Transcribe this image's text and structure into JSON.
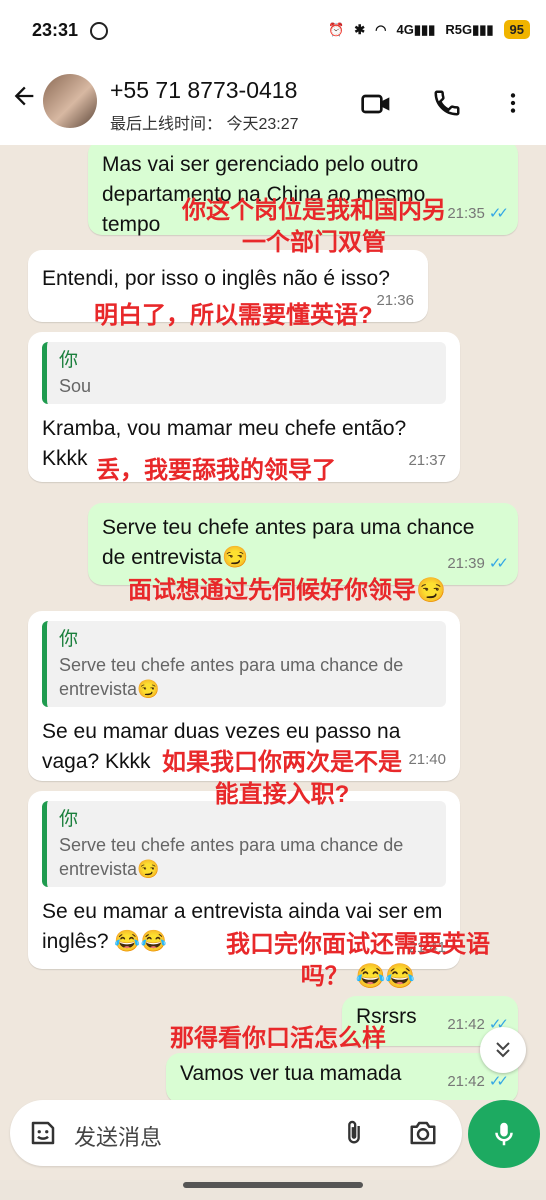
{
  "status_bar": {
    "time": "23:31",
    "signal_1": "4G",
    "signal_2": "5G",
    "signal_2_sub": "R",
    "battery": "95"
  },
  "header": {
    "contact_phone": "+55 71 8773-0418",
    "last_seen": "最后上线时间：  今天23:27"
  },
  "messages": [
    {
      "id": "m1",
      "type": "out",
      "text": "Mas vai ser gerenciado pelo outro departamento na China ao mesmo tempo",
      "time": "21:35",
      "ticks": "✓✓"
    },
    {
      "id": "m2",
      "type": "in",
      "text": "Entendi, por isso o inglês não é  isso?",
      "time": "21:36"
    },
    {
      "id": "m3",
      "type": "in",
      "quote_name": "你",
      "quote_text": "Sou",
      "text": "Kramba,  vou mamar meu chefe então? Kkkk",
      "time": "21:37"
    },
    {
      "id": "m4",
      "type": "out",
      "text": "Serve teu chefe antes para uma chance de entrevista😏",
      "time": "21:39",
      "ticks": "✓✓"
    },
    {
      "id": "m5",
      "type": "in",
      "quote_name": "你",
      "quote_text": "Serve teu chefe antes para uma chance de entrevista😏",
      "text": "Se eu mamar duas vezes eu passo na vaga? Kkkk",
      "time": "21:40"
    },
    {
      "id": "m6",
      "type": "in",
      "quote_name": "你",
      "quote_text": "Serve teu chefe antes para uma chance de entrevista😏",
      "text": "Se eu mamar a entrevista ainda vai ser em inglês? 😂😂",
      "time": "21:41"
    },
    {
      "id": "m7",
      "type": "out",
      "text": "Rsrsrs",
      "time": "21:42",
      "ticks": "✓✓"
    },
    {
      "id": "m8",
      "type": "out",
      "text": "Vamos ver tua mamada",
      "time": "21:42",
      "ticks": "✓✓"
    }
  ],
  "annotations": [
    {
      "id": "a1",
      "text": "你这个岗位是我和国内另\n一个部门双管"
    },
    {
      "id": "a2",
      "text": "明白了，所以需要懂英语?"
    },
    {
      "id": "a3",
      "text": "丢，我要舔我的领导了"
    },
    {
      "id": "a4",
      "text": "面试想通过先伺候好你领导😏"
    },
    {
      "id": "a5",
      "text": "如果我口你两次是不是\n能直接入职?"
    },
    {
      "id": "a6",
      "text": "我口完你面试还需要英语\n吗？ 😂😂"
    },
    {
      "id": "a7",
      "text": "那得看你口活怎么样"
    }
  ],
  "composer": {
    "placeholder": "发送消息"
  },
  "icons": {
    "back": "back-arrow-icon",
    "video": "video-call-icon",
    "call": "phone-call-icon",
    "menu": "more-vert-icon",
    "emoji": "sticker-icon",
    "attach": "paperclip-icon",
    "camera": "camera-icon",
    "mic": "microphone-icon",
    "scroll": "double-chevron-down-icon"
  },
  "colors": {
    "outgoing_bubble": "#d9fdd3",
    "incoming_bubble": "#ffffff",
    "accent_green": "#1daa61",
    "annotation_red": "#e8282a",
    "read_ticks": "#34a7e5"
  }
}
